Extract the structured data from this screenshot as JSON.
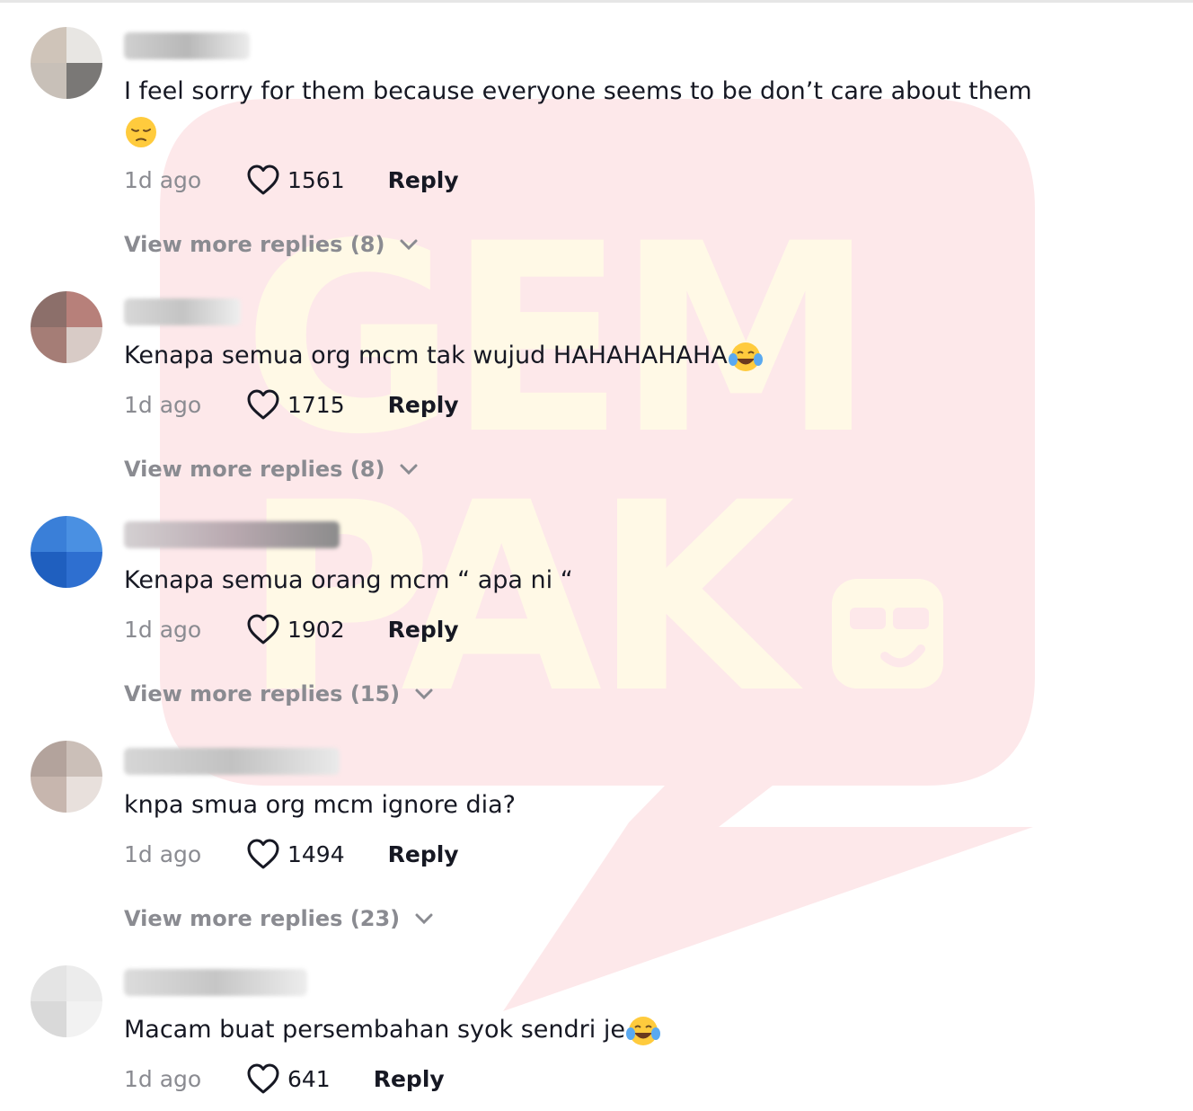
{
  "watermark": {
    "line1": "GEM",
    "line2": "PAK"
  },
  "comments": [
    {
      "text": "I feel sorry for them because everyone seems to be don’t care about them",
      "emoji": "pensive-face",
      "time": "1d ago",
      "likes": "1561",
      "reply_label": "Reply",
      "more_replies": "View more replies (8)"
    },
    {
      "text": "Kenapa semua org mcm tak wujud HAHAHAHAHA",
      "emoji": "tears-of-joy-face",
      "time": "1d ago",
      "likes": "1715",
      "reply_label": "Reply",
      "more_replies": "View more replies (8)"
    },
    {
      "text": "Kenapa semua orang mcm “ apa ni “",
      "time": "1d ago",
      "likes": "1902",
      "reply_label": "Reply",
      "more_replies": "View more replies (15)"
    },
    {
      "text": "knpa smua org mcm ignore dia?",
      "time": "1d ago",
      "likes": "1494",
      "reply_label": "Reply",
      "more_replies": "View more replies (23)"
    },
    {
      "text": "Macam buat persembahan syok sendri je",
      "emoji": "tears-of-joy-face",
      "time": "1d ago",
      "likes": "641",
      "reply_label": "Reply"
    }
  ],
  "colors": {
    "text": "#161823",
    "muted": "#8a8b91",
    "watermark_bubble": "#fde8ea",
    "watermark_letters": "#fffbe8"
  }
}
